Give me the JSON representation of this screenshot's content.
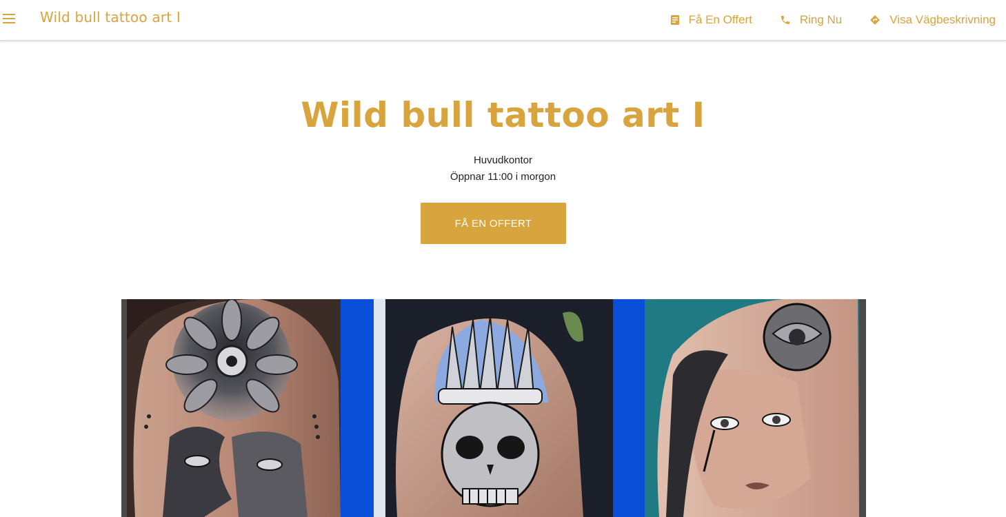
{
  "header": {
    "brand": "Wild bull tattoo art I",
    "nav": [
      {
        "label": "Få En Offert",
        "icon": "quote-document-icon"
      },
      {
        "label": "Ring Nu",
        "icon": "phone-icon"
      },
      {
        "label": "Visa Vägbeskrivning",
        "icon": "directions-icon"
      }
    ]
  },
  "hero": {
    "title": "Wild bull tattoo art I",
    "location": "Huvudkontor",
    "hours": "Öppnar 11:00 i morgon",
    "cta_label": "FÅ EN OFFERT"
  },
  "gallery": {
    "description": "tattoo-collage-image"
  },
  "colors": {
    "accent": "#d7a43e",
    "text": "#222222",
    "background": "#ffffff"
  }
}
